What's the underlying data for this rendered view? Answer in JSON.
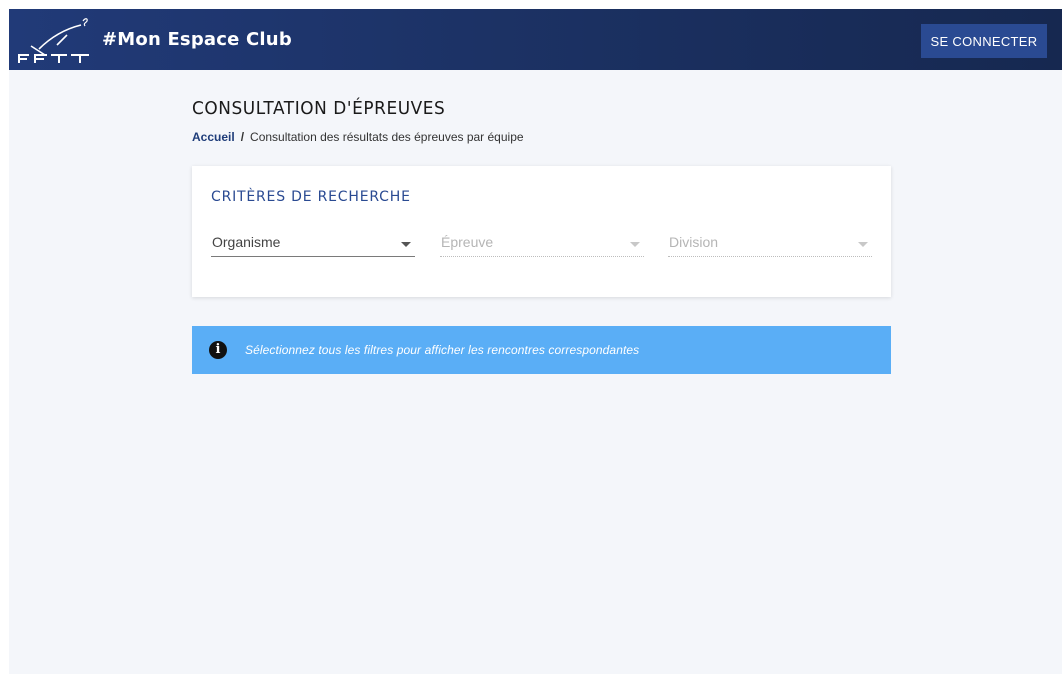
{
  "header": {
    "logo_text": "FFTT",
    "app_title": "#Mon Espace Club",
    "login_label": "SE CONNECTER",
    "background_color": "#1c3265"
  },
  "page": {
    "title": "CONSULTATION D'ÉPREUVES",
    "breadcrumb": {
      "home": "Accueil",
      "separator": "/",
      "current": "Consultation des résultats des épreuves par équipe"
    }
  },
  "search_criteria": {
    "title": "CRITÈRES DE RECHERCHE",
    "fields": [
      {
        "label": "Organisme",
        "enabled": true
      },
      {
        "label": "Épreuve",
        "enabled": false
      },
      {
        "label": "Division",
        "enabled": false
      }
    ]
  },
  "alert": {
    "icon": "info-icon",
    "text": "Sélectionnez tous les filtres pour afficher les rencontres correspondantes",
    "color": "#5aaef6"
  }
}
